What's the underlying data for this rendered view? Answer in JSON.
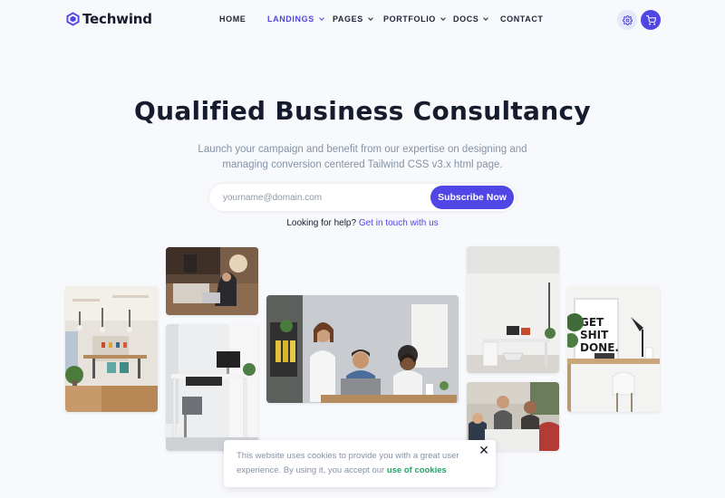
{
  "brand": {
    "name": "Techwind",
    "accent": "#4f46e5"
  },
  "nav": {
    "items": [
      {
        "label": "HOME",
        "active": false,
        "dropdown": false
      },
      {
        "label": "LANDINGS",
        "active": true,
        "dropdown": true
      },
      {
        "label": "PAGES",
        "active": false,
        "dropdown": true
      },
      {
        "label": "PORTFOLIO",
        "active": false,
        "dropdown": true
      },
      {
        "label": "DOCS",
        "active": false,
        "dropdown": true
      },
      {
        "label": "CONTACT",
        "active": false,
        "dropdown": false
      }
    ],
    "icons": [
      "settings-icon",
      "cart-icon"
    ]
  },
  "hero": {
    "title": "Qualified Business Consultancy",
    "subtitle": "Launch your campaign and benefit from our expertise on designing and managing conversion centered Tailwind CSS v3.x html page."
  },
  "subscribe": {
    "placeholder": "yourname@domain.com",
    "value": "",
    "button_label": "Subscribe Now"
  },
  "help": {
    "prefix": "Looking for help? ",
    "link": "Get in touch with us"
  },
  "gallery": {
    "photos": [
      "office-interior",
      "woman-at-laptop",
      "white-desk-workspace",
      "team-meeting",
      "white-room-desk",
      "group-discussion",
      "get-shit-done-desk"
    ],
    "poster_text": [
      "GET",
      "SHIT",
      "DONE."
    ]
  },
  "cookie": {
    "text": "This website uses cookies to provide you with a great user experience. By using it, you accept our ",
    "link": "use of cookies",
    "close": "✕"
  }
}
